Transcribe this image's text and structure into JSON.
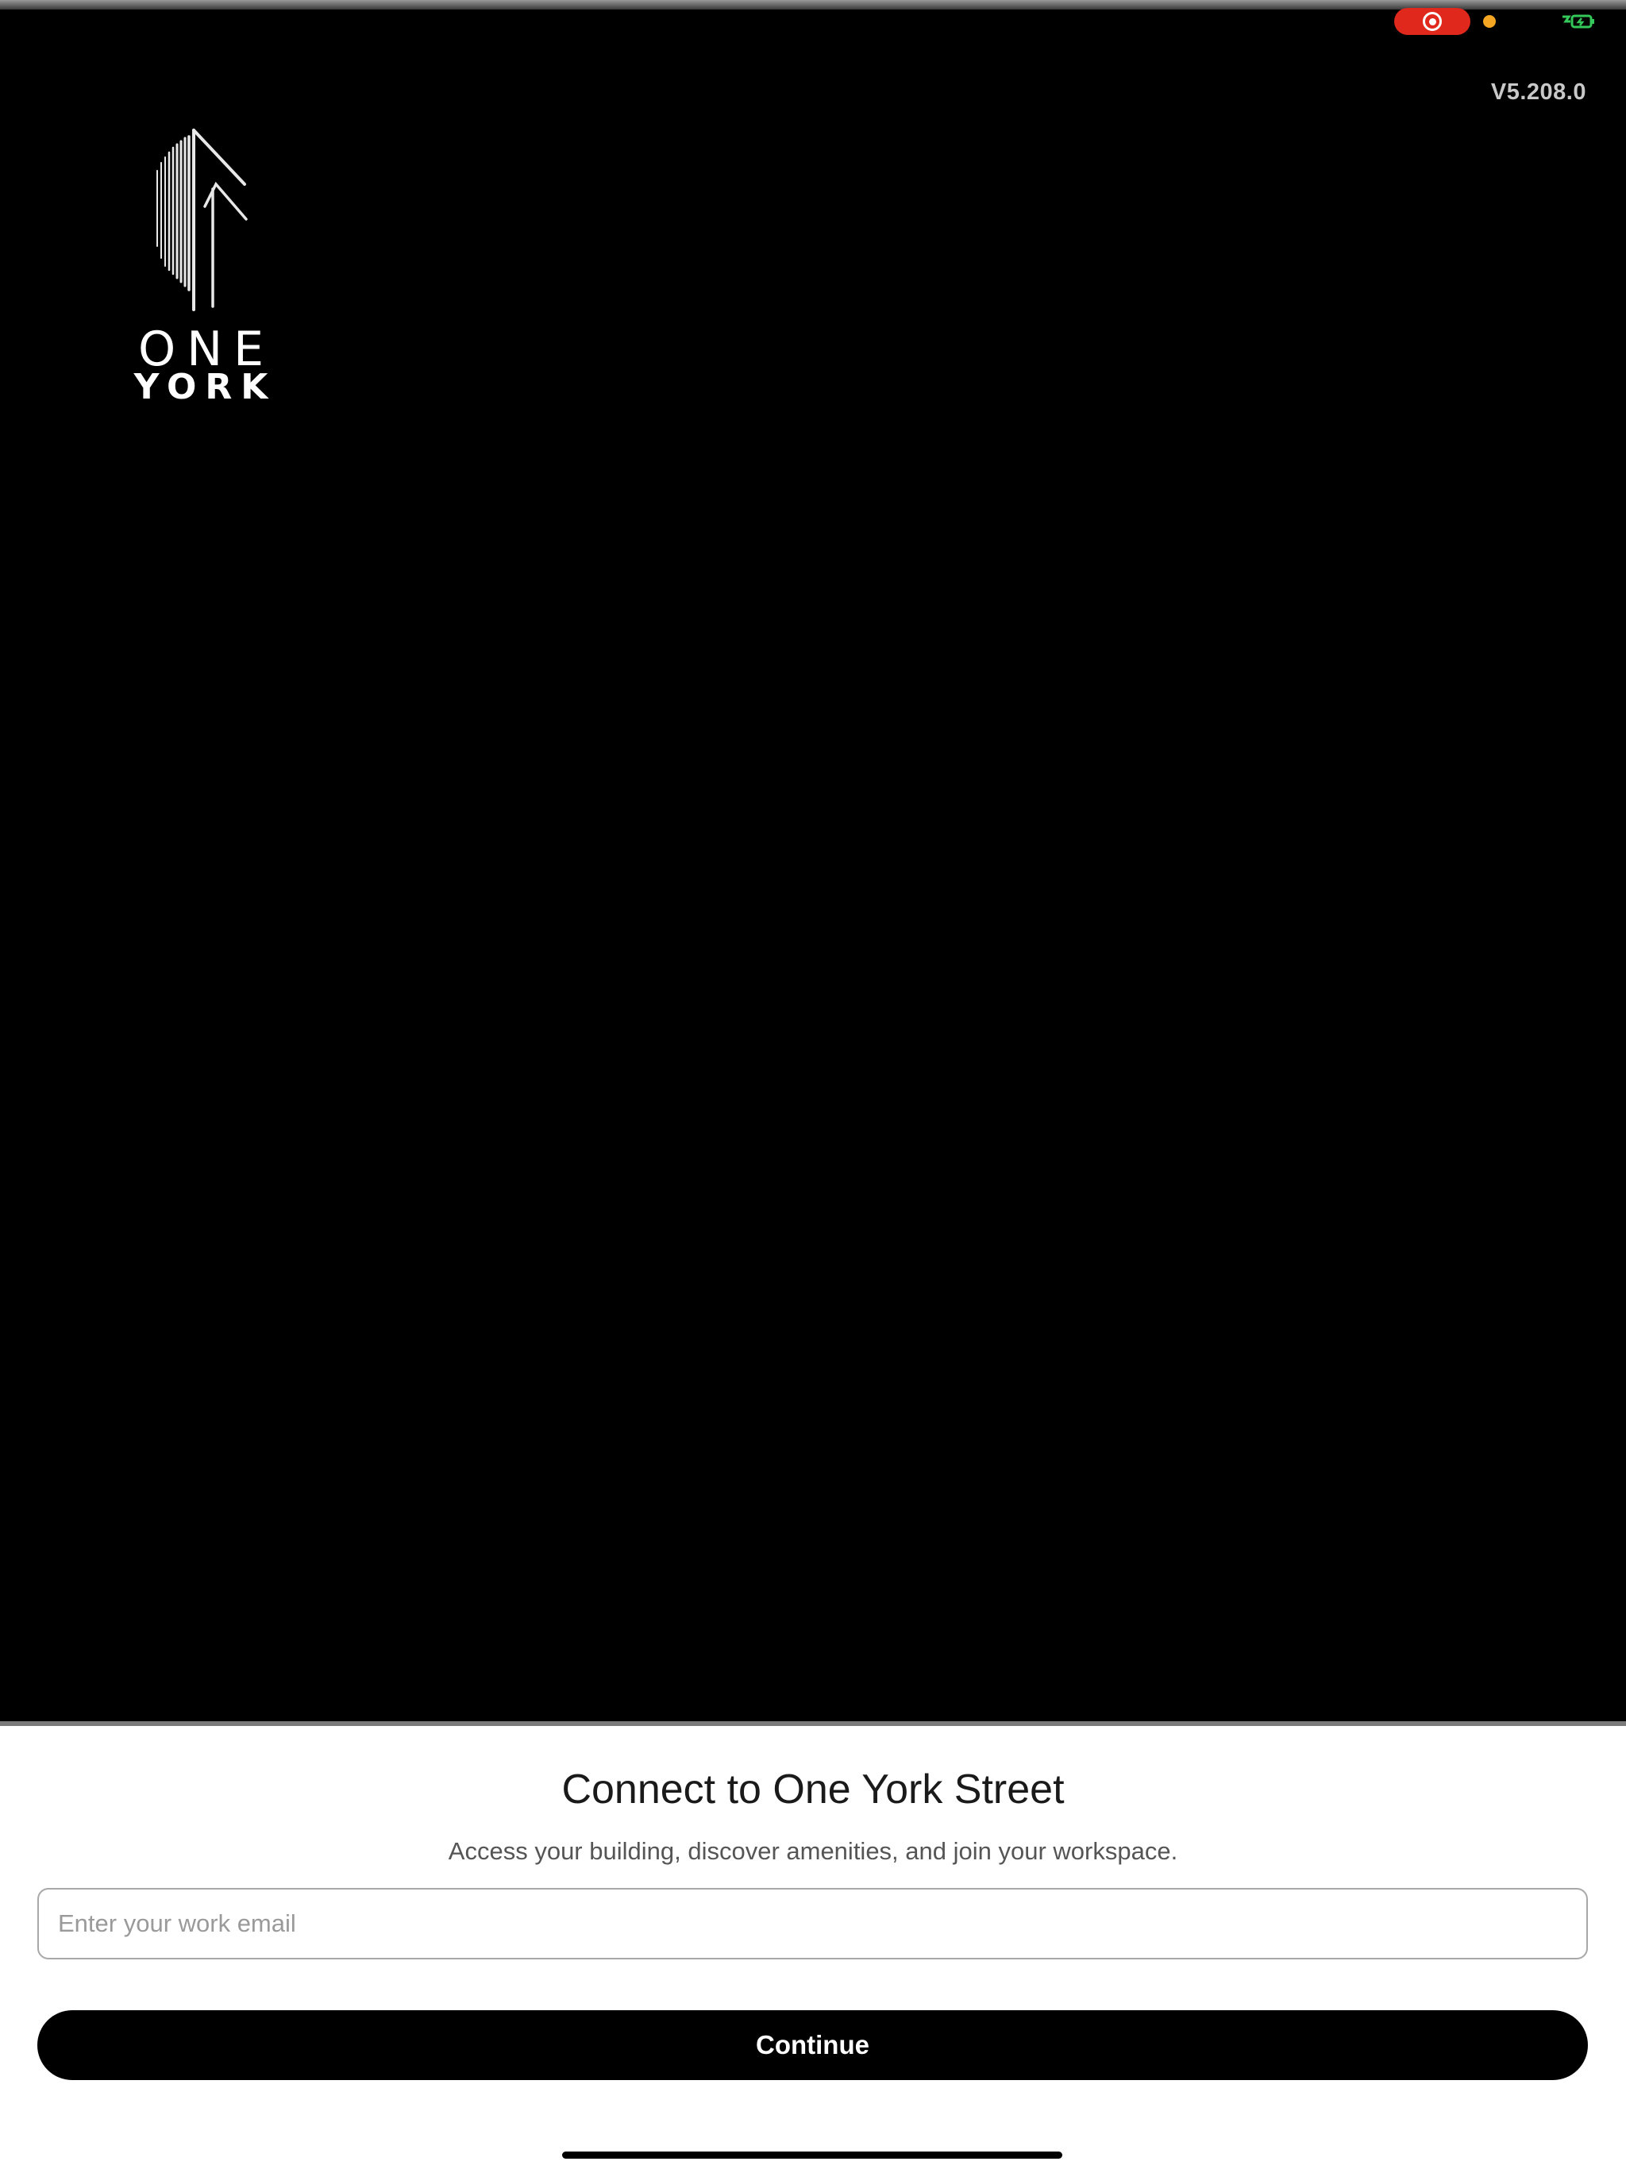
{
  "status_bar": {
    "recording_icon": "screen-record-icon",
    "mic_indicator": "orange-dot",
    "battery_icon": "battery-charging-icon"
  },
  "app": {
    "version": "V5.208.0",
    "logo": {
      "line1": "ONE",
      "line2": "YORK"
    }
  },
  "signin": {
    "title": "Connect to One York Street",
    "subtitle": "Access your building, discover amenities, and join your workspace.",
    "email_placeholder": "Enter your work email",
    "email_value": "",
    "continue_label": "Continue"
  },
  "colors": {
    "background": "#000000",
    "sheet": "#ffffff",
    "button": "#000000",
    "recording": "#e0281c",
    "mic_dot": "#f5a623",
    "battery": "#34c759"
  }
}
